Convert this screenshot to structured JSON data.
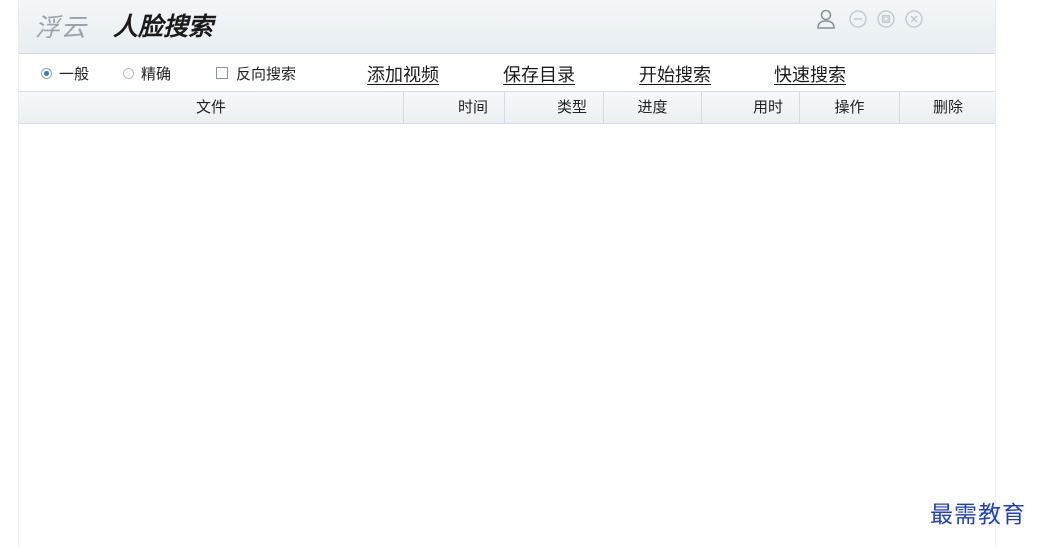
{
  "app": {
    "brand_light": "浮云",
    "brand_dark": "人脸搜索"
  },
  "window_controls": {
    "user_icon": "user-icon",
    "minimize_icon": "minimize-icon",
    "restore_icon": "restore-icon",
    "close_icon": "close-icon"
  },
  "toolbar": {
    "mode_general": "一般",
    "mode_precise": "精确",
    "mode_selected": "一般",
    "reverse_search": "反向搜索",
    "reverse_search_checked": false,
    "add_video": "添加视频",
    "save_dir": "保存目录",
    "start_search": "开始搜索",
    "quick_search": "快速搜索"
  },
  "table": {
    "columns": [
      "文件",
      "时间",
      "类型",
      "进度",
      "用时",
      "操作",
      "删除"
    ],
    "rows": []
  },
  "watermark": "最需教育",
  "colors": {
    "accent": "#3a78c2",
    "watermark": "#1f3fc6"
  }
}
